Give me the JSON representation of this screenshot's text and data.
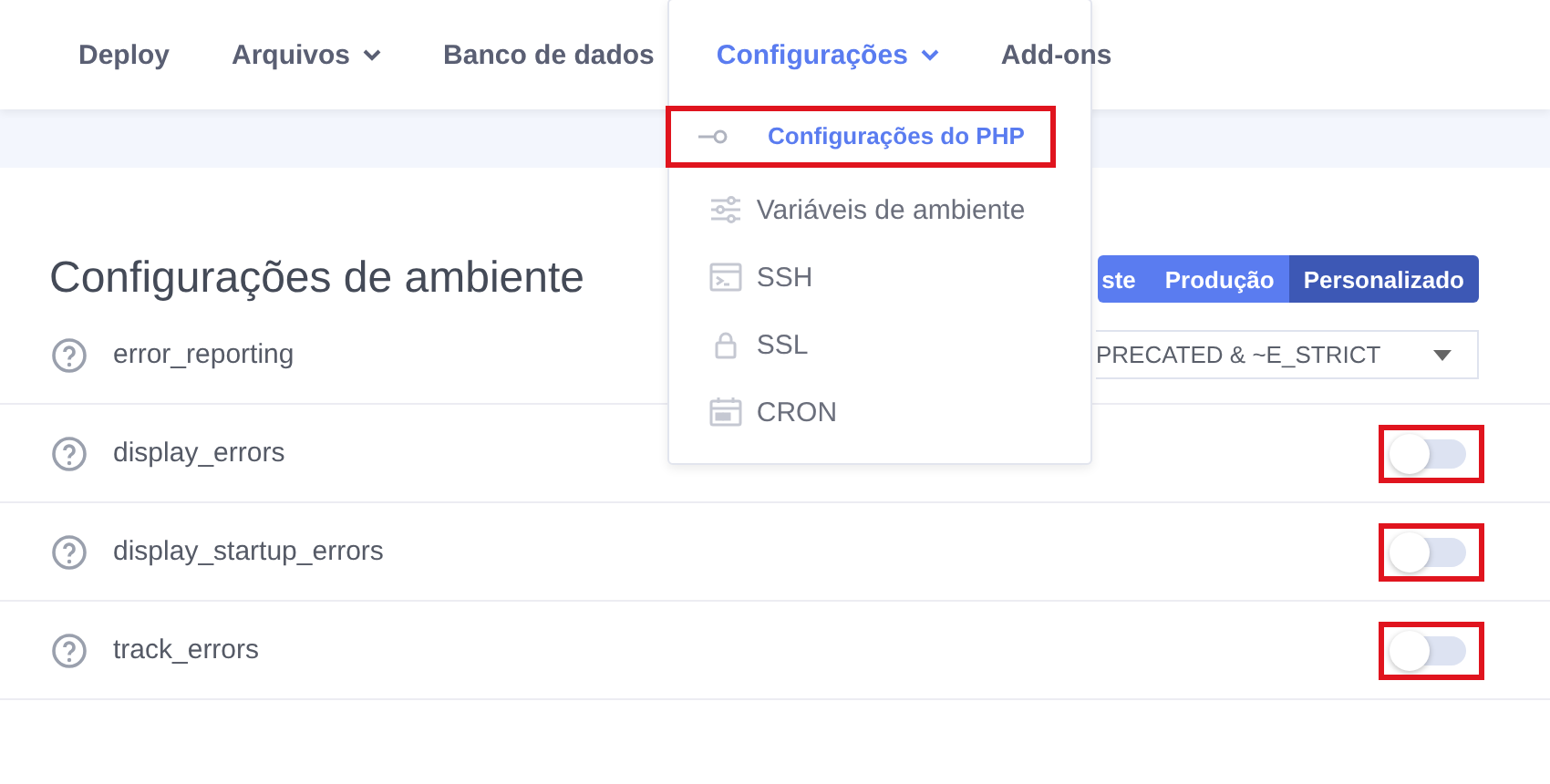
{
  "nav": {
    "items": [
      {
        "label": "Deploy",
        "selected": false,
        "has_caret": false
      },
      {
        "label": "Arquivos",
        "selected": false,
        "has_caret": true
      },
      {
        "label": "Banco de dados",
        "selected": false,
        "has_caret": false
      },
      {
        "label": "Configurações",
        "selected": true,
        "has_caret": true,
        "menu": [
          {
            "label": "Configurações do PHP",
            "selected": true,
            "highlighted": true
          },
          {
            "label": "Variáveis de ambiente",
            "selected": false,
            "highlighted": false
          },
          {
            "label": "SSH",
            "selected": false,
            "highlighted": false
          },
          {
            "label": "SSL",
            "selected": false,
            "highlighted": false
          },
          {
            "label": "CRON",
            "selected": false,
            "highlighted": false
          }
        ]
      },
      {
        "label": "Add-ons",
        "selected": false,
        "has_caret": false
      }
    ]
  },
  "title": "Configurações de ambiente",
  "presets": [
    {
      "label": "ste",
      "selected": false
    },
    {
      "label": "Produção",
      "selected": false
    },
    {
      "label": "Personalizado",
      "selected": true
    }
  ],
  "settings": [
    {
      "kind": "select",
      "name": "error_reporting",
      "value": "PRECATED & ~E_STRICT"
    },
    {
      "kind": "toggle",
      "name": "display_errors",
      "on": false,
      "annotated": true
    },
    {
      "kind": "toggle",
      "name": "display_startup_errors",
      "on": false,
      "annotated": true
    },
    {
      "kind": "toggle",
      "name": "track_errors",
      "on": false,
      "annotated": true
    }
  ]
}
